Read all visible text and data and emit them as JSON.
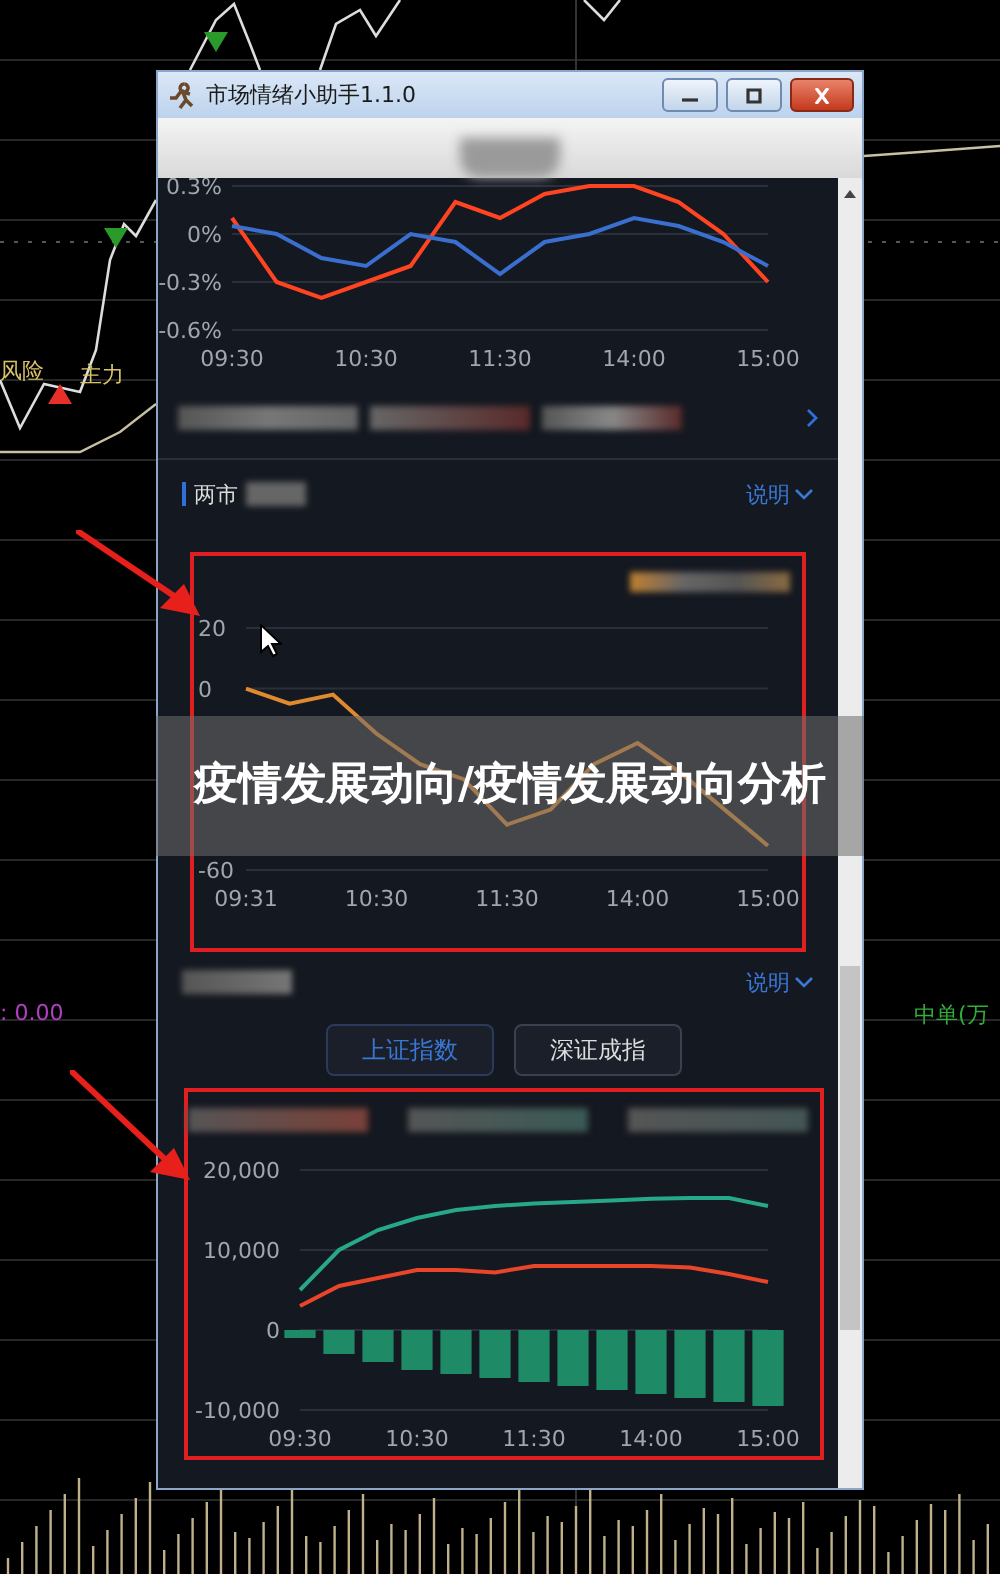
{
  "background_labels": [
    {
      "text": "风险",
      "color": "#d9c36a"
    },
    {
      "text": "主力",
      "color": "#d9c36a"
    },
    {
      "text": ": 0.00",
      "color": "#b33fc4"
    },
    {
      "text": "中单(万",
      "color": "#2fae3c"
    }
  ],
  "window": {
    "title": "市场情绪小助手1.1.0"
  },
  "index_chart": {
    "chart_data": {
      "type": "line",
      "ylim": [
        -0.6,
        0.3
      ],
      "categories": [
        "09:30",
        null,
        null,
        "10:30",
        null,
        null,
        "11:30",
        null,
        null,
        "14:00",
        null,
        null,
        "15:00"
      ],
      "yticks": [
        {
          "value": 0.3,
          "label": "0.3%"
        },
        {
          "value": 0,
          "label": "0%"
        },
        {
          "value": -0.3,
          "label": "-0.3%"
        },
        {
          "value": -0.6,
          "label": "-0.6%"
        }
      ],
      "series": [
        {
          "color": "#ff4422",
          "values": [
            0.1,
            -0.3,
            -0.4,
            -0.3,
            -0.2,
            0.2,
            0.1,
            0.25,
            0.3,
            0.3,
            0.2,
            0.0,
            -0.3
          ]
        },
        {
          "color": "#3a6fd0",
          "values": [
            0.05,
            0.0,
            -0.15,
            -0.2,
            0.0,
            -0.05,
            -0.25,
            -0.05,
            0.0,
            0.1,
            0.05,
            -0.05,
            -0.2
          ]
        }
      ]
    }
  },
  "sections": [
    {
      "title": "两市",
      "link": "说明",
      "chart_data": {
        "type": "line",
        "ylim": [
          -60,
          20
        ],
        "categories": [
          "09:31",
          null,
          null,
          "10:30",
          null,
          null,
          "11:30",
          null,
          null,
          "14:00",
          null,
          null,
          "15:00"
        ],
        "yticks": [
          20,
          0,
          -60
        ],
        "series": [
          {
            "color": "#e08a30",
            "values": [
              0,
              -5,
              -2,
              -15,
              -25,
              -30,
              -45,
              -40,
              -25,
              -18,
              -28,
              -40,
              -52
            ]
          }
        ]
      }
    },
    {
      "link": "说明",
      "tabs": [
        {
          "label": "上证指数",
          "selected": true
        },
        {
          "label": "深证成指",
          "selected": false
        }
      ],
      "chart_data": {
        "type": "line",
        "ylim": [
          -10000,
          20000
        ],
        "categories": [
          "09:30",
          null,
          null,
          "10:30",
          null,
          null,
          "11:30",
          null,
          null,
          "14:00",
          null,
          null,
          "15:00"
        ],
        "yticks": [
          {
            "value": 20000,
            "label": "20,000"
          },
          {
            "value": 10000,
            "label": "10,000"
          },
          {
            "value": 0,
            "label": "0"
          },
          {
            "value": -10000,
            "label": "-10,000"
          }
        ],
        "series": [
          {
            "type": "line",
            "color": "#27a88a",
            "values": [
              5000,
              10000,
              12500,
              14000,
              15000,
              15500,
              15800,
              16000,
              16200,
              16400,
              16500,
              16500,
              15500
            ]
          },
          {
            "type": "line",
            "color": "#e8452a",
            "values": [
              3000,
              5500,
              6500,
              7500,
              7500,
              7200,
              8000,
              8000,
              8000,
              8000,
              7800,
              7000,
              6000
            ]
          },
          {
            "type": "bar",
            "color": "#1f8a66",
            "values": [
              -1000,
              -3000,
              -4000,
              -5000,
              -5500,
              -6000,
              -6500,
              -7000,
              -7500,
              -8000,
              -8500,
              -9000,
              -9500
            ]
          }
        ]
      }
    }
  ],
  "banner": {
    "text": "疫情发展动向/疫情发展动向分析"
  }
}
